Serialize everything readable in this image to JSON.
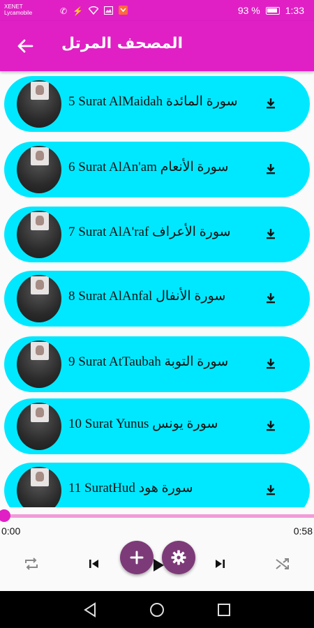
{
  "status_bar": {
    "carrier_line1": "XENET",
    "carrier_line2": "Lycamobile",
    "battery_percent": "93 %",
    "time": "1:33"
  },
  "app_bar": {
    "title": "المصحف المرتل",
    "back_icon": "arrow-back-icon",
    "color": "#e020c4"
  },
  "surah_list": {
    "item_color": "#00e8ff",
    "items": [
      {
        "title": "5 Surat AlMaidah سورة المائدة"
      },
      {
        "title": "6 Surat AlAn'am سورة الأنعام"
      },
      {
        "title": "7 Surat AlA'raf سورة الأعراف"
      },
      {
        "title": "8 Surat AlAnfal سورة الأنفال"
      },
      {
        "title": "9 Surat AtTaubah سورة التوبة"
      },
      {
        "title": "10 Surat Yunus سورة يونس"
      },
      {
        "title": "11 SuratHud سورة هود"
      }
    ]
  },
  "player": {
    "elapsed": "0:00",
    "duration": "0:58",
    "progress": 0.0,
    "accent": "#e020c4",
    "fab_color": "#7d3a78"
  }
}
